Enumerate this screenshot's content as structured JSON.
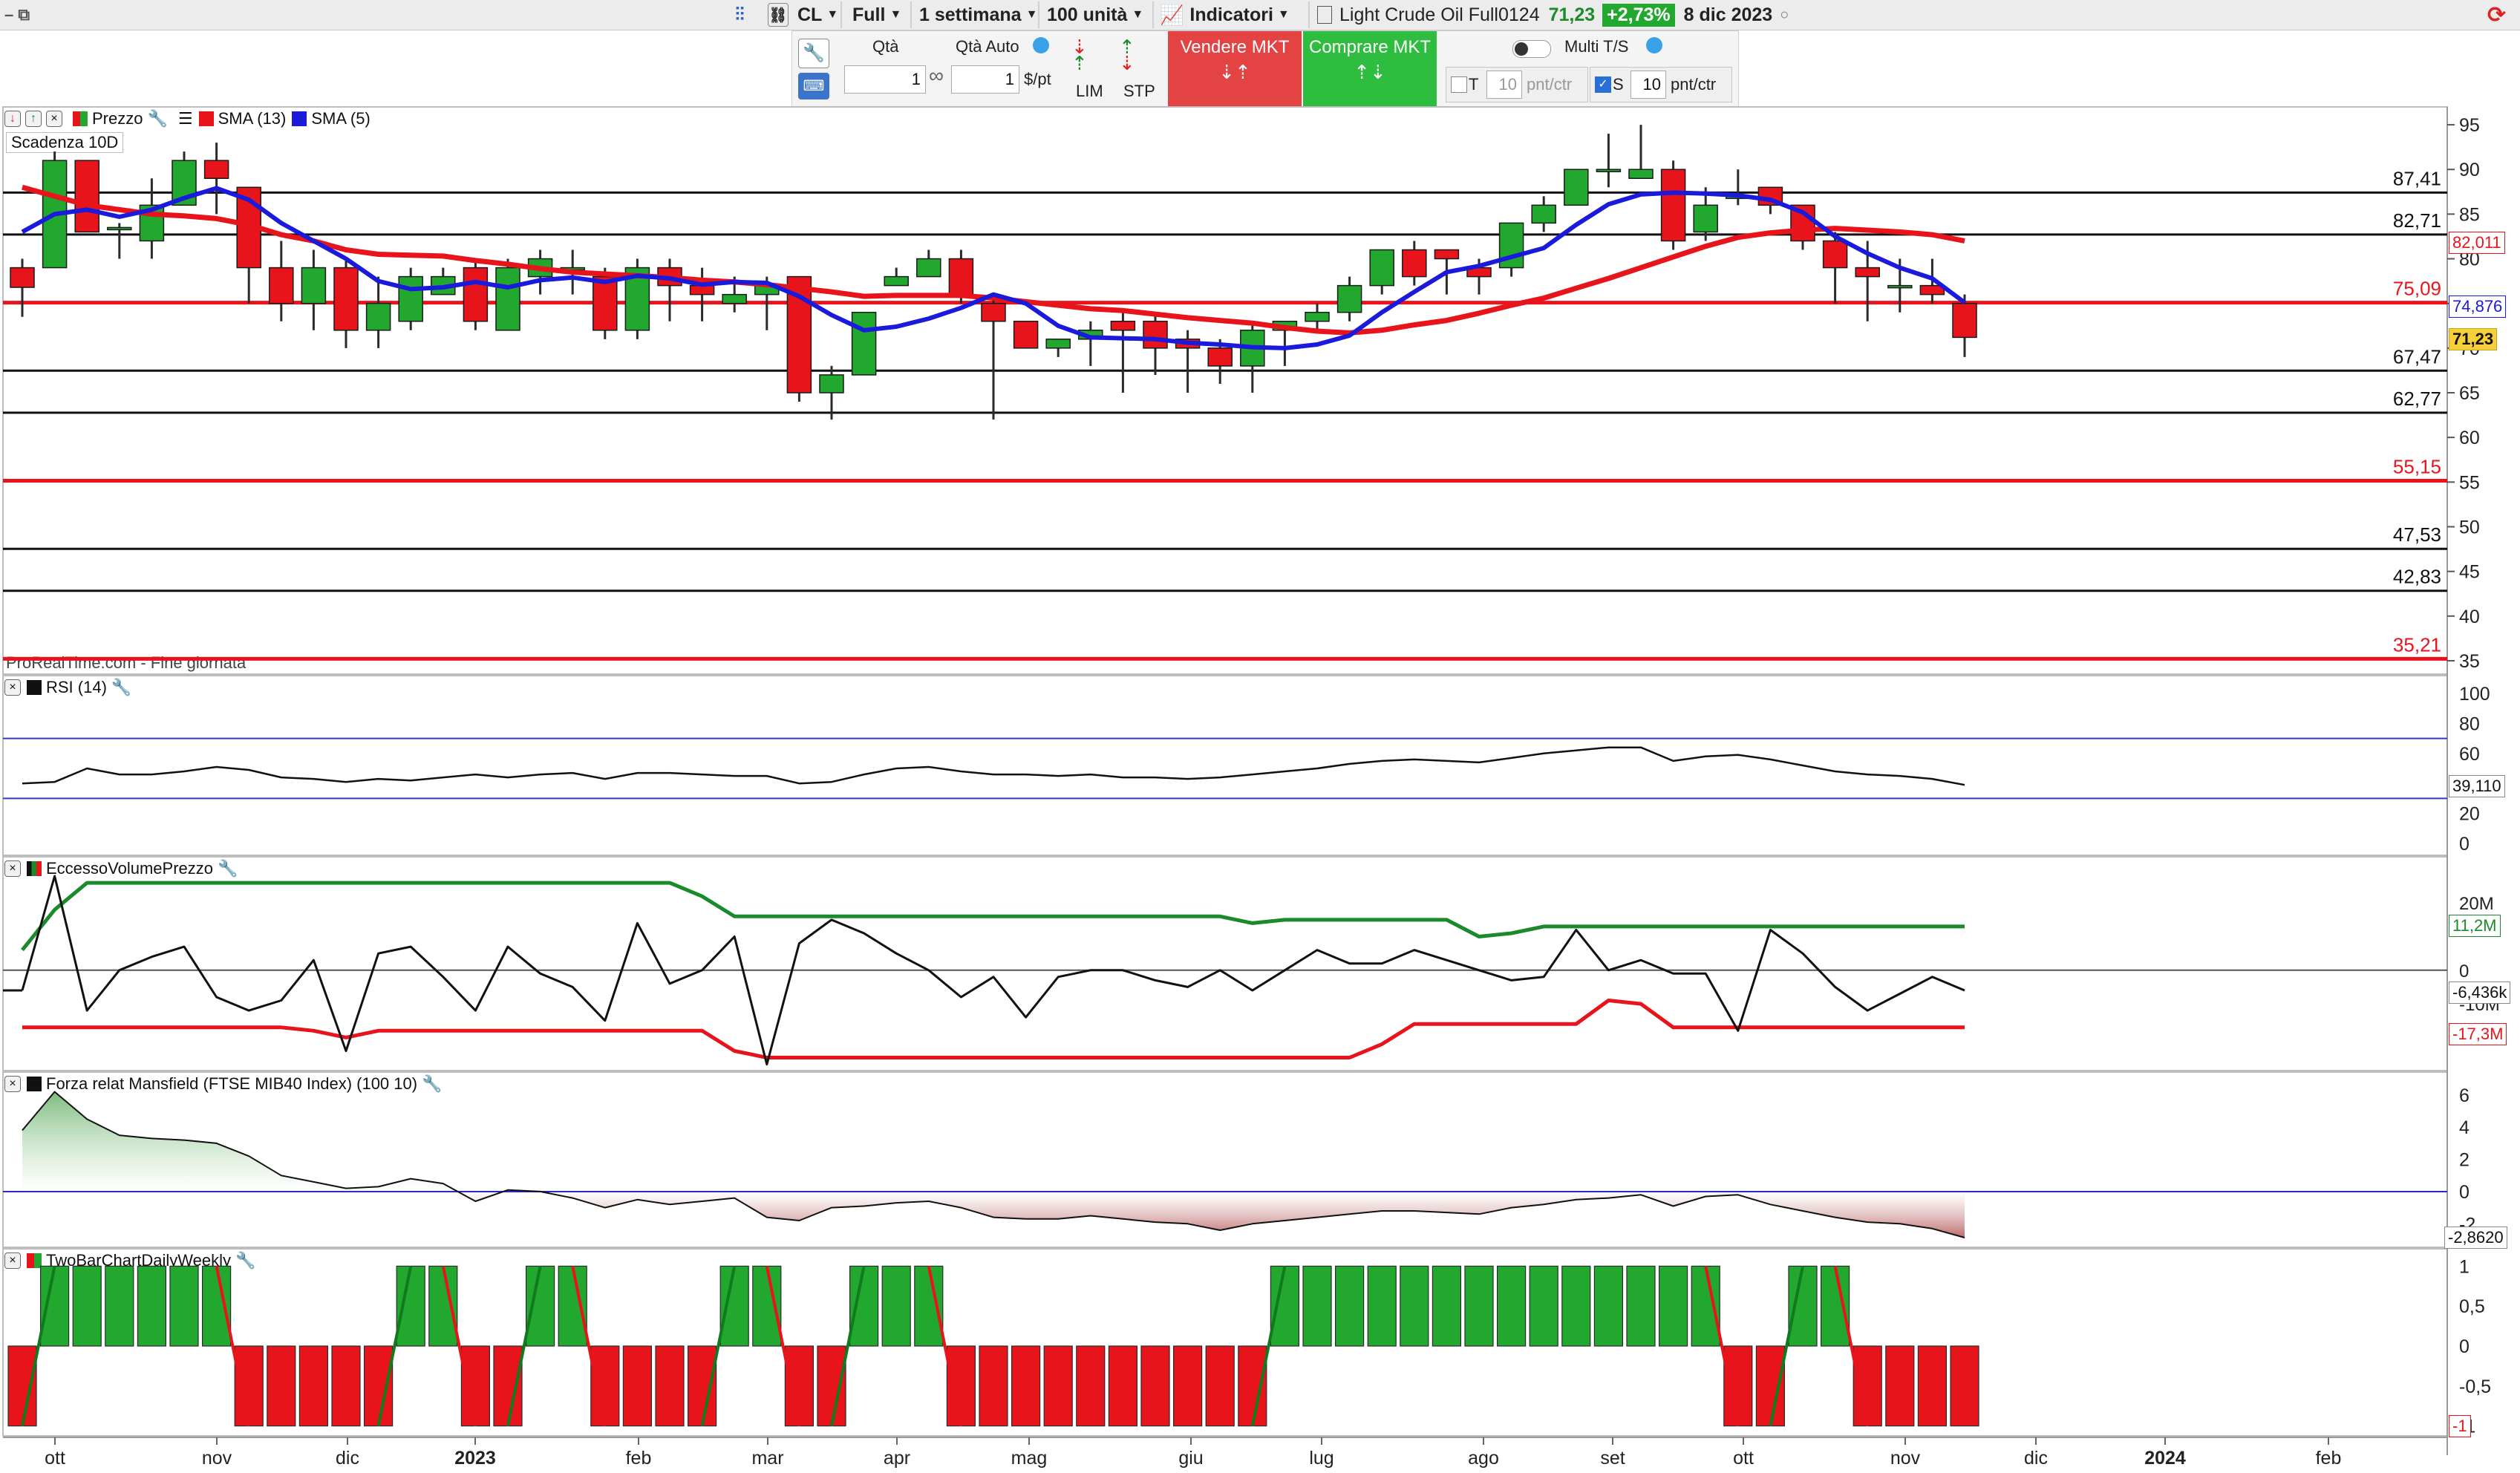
{
  "toolbar": {
    "symbol": "CL",
    "mode": "Full",
    "timeframe": "1 settimana",
    "units": "100 unità",
    "indicators_label": "Indicatori",
    "instrument": "Light Crude Oil Full0124",
    "last_price": "71,23",
    "change_pct": "+2,73%",
    "date": "8 dic 2023"
  },
  "order_panel": {
    "qty_label": "Qtà",
    "qty_value": "1",
    "qty_auto_label": "Qtà Auto",
    "qty_auto_value": "1",
    "unit_label": "$/pt",
    "lim_label": "LIM",
    "stp_label": "STP",
    "sell_label": "Vendere MKT",
    "buy_label": "Comprare MKT",
    "multi_label": "Multi T/S",
    "t_label": "T",
    "t_value": "10",
    "t_unit": "pnt/ctr",
    "s_label": "S",
    "s_value": "10",
    "s_unit": "pnt/ctr"
  },
  "colors": {
    "up": "#22a82f",
    "down": "#e8141b",
    "sma13": "#e8141b",
    "sma5": "#1a1adc",
    "sell_bg": "#e34343",
    "buy_bg": "#2fbd3f"
  },
  "price_panel": {
    "header": {
      "prezzo": "Prezzo",
      "sma13": "SMA (13)",
      "sma5": "SMA (5)"
    },
    "expiry_label": "Scadenza 10D",
    "watermark": "ProRealTime.com - Fine giornata",
    "axis_ticks": [
      95,
      90,
      85,
      80,
      75,
      70,
      65,
      60,
      55,
      50,
      45,
      40,
      35
    ],
    "axis_tags": {
      "sma13": "82,011",
      "sma5": "74,876",
      "price": "71,23"
    },
    "hlines": [
      {
        "value": 87.41,
        "label": "87,41",
        "color": "black"
      },
      {
        "value": 82.71,
        "label": "82,71",
        "color": "black"
      },
      {
        "value": 75.09,
        "label": "75,09",
        "color": "red"
      },
      {
        "value": 67.47,
        "label": "67,47",
        "color": "black"
      },
      {
        "value": 62.77,
        "label": "62,77",
        "color": "black"
      },
      {
        "value": 55.15,
        "label": "55,15",
        "color": "red"
      },
      {
        "value": 47.53,
        "label": "47,53",
        "color": "black"
      },
      {
        "value": 42.83,
        "label": "42,83",
        "color": "black"
      },
      {
        "value": 35.21,
        "label": "35,21",
        "color": "red"
      }
    ]
  },
  "rsi_panel": {
    "title": "RSI (14)",
    "ticks": [
      100,
      80,
      60,
      40,
      20,
      0
    ],
    "value_tag": "39,110"
  },
  "evp_panel": {
    "title": "EccessoVolumePrezzo",
    "ticks": [
      "20M",
      "0",
      "-10M",
      "-20M"
    ],
    "upper_tag": "11,2M",
    "value_tag": "-6,436k",
    "lower_tag": "-17,3M"
  },
  "mansfield_panel": {
    "title": "Forza relat Mansfield (FTSE MIB40 Index) (100 10)",
    "ticks": [
      6,
      4,
      2,
      0,
      -2
    ],
    "value_tag": "-2,8620"
  },
  "twobar_panel": {
    "title": "TwoBarChartDailyWeekly",
    "ticks": [
      "1",
      "0,5",
      "0",
      "-0,5",
      "-1"
    ],
    "value_tag": "-1"
  },
  "x_axis": {
    "labels": [
      "ott",
      "nov",
      "dic",
      "2023",
      "feb",
      "mar",
      "apr",
      "mag",
      "giu",
      "lug",
      "ago",
      "set",
      "ott",
      "nov",
      "dic",
      "2024",
      "feb"
    ]
  },
  "chart_data": {
    "type": "candlestick",
    "x_unit": "week",
    "ohlc": [
      [
        79,
        80,
        73.5,
        76.8
      ],
      [
        79,
        92,
        79,
        91
      ],
      [
        91,
        91,
        83,
        83
      ],
      [
        83.5,
        84,
        80,
        83.5
      ],
      [
        82,
        89,
        80,
        86
      ],
      [
        86,
        92,
        86,
        91
      ],
      [
        91,
        93,
        85,
        89
      ],
      [
        88,
        88,
        75,
        79
      ],
      [
        79,
        82,
        73,
        75
      ],
      [
        75,
        81,
        72,
        79
      ],
      [
        79,
        80,
        70,
        72
      ],
      [
        72,
        78,
        70,
        75
      ],
      [
        73,
        79,
        72,
        78
      ],
      [
        76,
        79,
        76,
        78
      ],
      [
        79,
        80,
        72,
        73
      ],
      [
        72,
        80,
        72,
        79
      ],
      [
        78,
        81,
        76,
        80
      ],
      [
        79,
        81,
        76,
        79
      ],
      [
        78,
        79,
        71,
        72
      ],
      [
        72,
        80,
        71,
        79
      ],
      [
        79,
        80,
        73,
        77
      ],
      [
        77,
        79,
        73,
        76
      ],
      [
        75,
        78,
        74,
        76
      ],
      [
        76,
        78,
        72,
        77
      ],
      [
        78,
        78,
        64,
        65
      ],
      [
        65,
        68,
        62,
        67
      ],
      [
        67,
        74,
        67,
        74
      ],
      [
        77,
        79,
        77,
        78
      ],
      [
        78,
        81,
        78,
        80
      ],
      [
        80,
        81,
        75,
        76
      ],
      [
        75,
        76,
        62,
        73
      ],
      [
        73,
        73,
        70,
        70
      ],
      [
        70,
        71,
        69,
        71
      ],
      [
        71,
        73,
        68,
        72
      ],
      [
        73,
        74,
        65,
        72
      ],
      [
        73,
        74,
        67,
        70
      ],
      [
        71,
        72,
        65,
        70
      ],
      [
        70,
        71,
        66,
        68
      ],
      [
        68,
        73,
        65,
        72
      ],
      [
        72,
        73,
        68,
        73
      ],
      [
        73,
        75,
        72,
        74
      ],
      [
        74,
        78,
        73,
        77
      ],
      [
        77,
        81,
        76,
        81
      ],
      [
        81,
        82,
        77,
        78
      ],
      [
        81,
        81,
        76,
        80
      ],
      [
        79,
        80,
        76,
        78
      ],
      [
        79,
        84,
        78,
        84
      ],
      [
        84,
        87,
        83,
        86
      ],
      [
        86,
        90,
        86,
        90
      ],
      [
        90,
        94,
        88,
        90
      ],
      [
        89,
        95,
        89,
        90
      ],
      [
        90,
        91,
        81,
        82
      ],
      [
        83,
        88,
        82,
        86
      ],
      [
        87,
        90,
        86,
        87
      ],
      [
        88,
        88,
        85,
        86
      ],
      [
        86,
        86,
        81,
        82
      ],
      [
        82,
        83,
        75,
        79
      ],
      [
        79,
        82,
        73,
        78
      ],
      [
        77,
        80,
        74,
        77
      ],
      [
        77,
        80,
        75,
        76
      ],
      [
        75,
        76,
        69,
        71.2
      ]
    ],
    "sma5": [
      83,
      85,
      85.5,
      84.7,
      85.5,
      86.8,
      87.9,
      86.6,
      84,
      82,
      80,
      77.5,
      76.6,
      76.8,
      77.4,
      76.8,
      77.6,
      77.9,
      77.4,
      78.1,
      77.8,
      77.1,
      77.4,
      77.3,
      75.8,
      73.7,
      72,
      72.4,
      73.3,
      74.5,
      76,
      75,
      72.5,
      71.2,
      71.1,
      71,
      70.6,
      70.4,
      70.1,
      70,
      70.4,
      71.4,
      74,
      76.3,
      78.5,
      79.2,
      80.2,
      81.2,
      83.8,
      86.1,
      87.2,
      87.4,
      87.3,
      87.1,
      86.6,
      85.2,
      82.5,
      80.6,
      79,
      77.8,
      75.1
    ],
    "sma13": [
      88,
      87,
      86,
      85.5,
      85,
      84.8,
      84.5,
      83.8,
      82.7,
      82,
      81,
      80.5,
      80.4,
      80.3,
      79.8,
      79.4,
      78.9,
      78.5,
      78.3,
      78.1,
      77.9,
      77.6,
      77.4,
      77.1,
      76.7,
      76.3,
      75.8,
      75.9,
      75.9,
      75.9,
      75.6,
      75.2,
      74.8,
      74.4,
      74.2,
      73.8,
      73.4,
      73.1,
      72.8,
      72.3,
      71.9,
      71.7,
      72,
      72.6,
      73.1,
      73.9,
      74.8,
      75.6,
      76.7,
      77.8,
      79,
      80.2,
      81.4,
      82.4,
      82.9,
      83.2,
      83.4,
      83.2,
      83,
      82.7,
      82
    ]
  }
}
